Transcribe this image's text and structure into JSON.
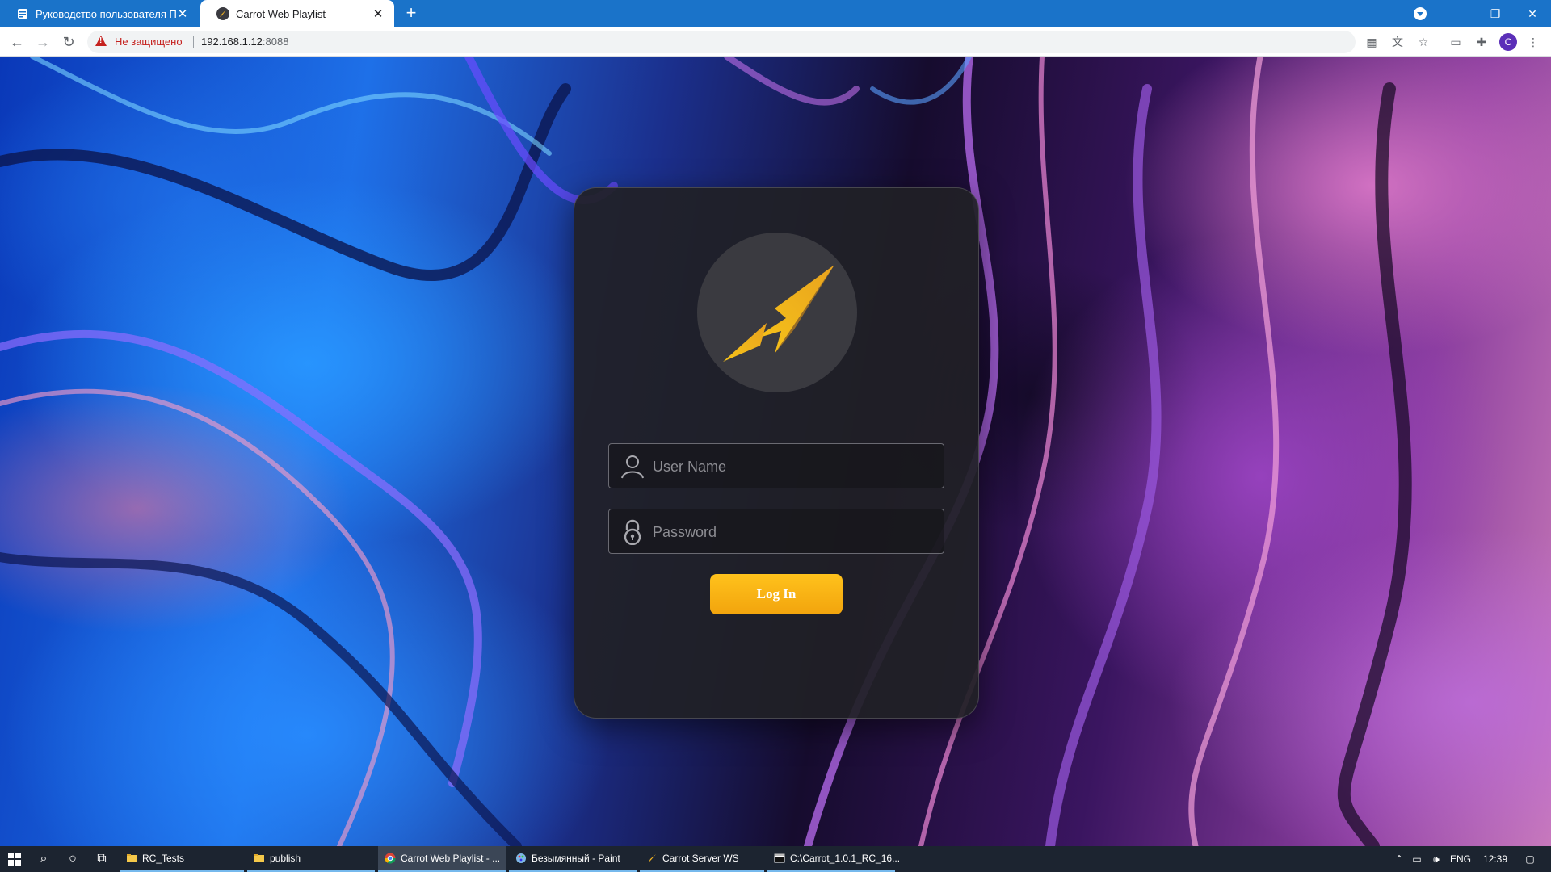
{
  "browser": {
    "tabs": [
      {
        "title": "Руководство пользователя ПО",
        "active": false,
        "icon": "document-icon"
      },
      {
        "title": "Carrot Web Playlist",
        "active": true,
        "icon": "carrot-logo-icon"
      }
    ],
    "address": {
      "security_label": "Не защищено",
      "host": "192.168.1.12",
      "port": ":8088"
    },
    "profile_initial": "C",
    "toolbar_icons": [
      "qr-code-icon",
      "translate-icon",
      "star-icon",
      "cast-icon",
      "extensions-icon",
      "profile-avatar",
      "menu-kebab-icon"
    ]
  },
  "login": {
    "username_placeholder": "User Name",
    "password_placeholder": "Password",
    "login_label": "Log In",
    "accent_color": "#f5aa12",
    "icons": {
      "user": "user-icon",
      "password": "lock-icon",
      "logo": "arrow-logo-icon"
    }
  },
  "taskbar": {
    "items": [
      {
        "label": "RC_Tests",
        "icon": "folder-icon",
        "active": false
      },
      {
        "label": "publish",
        "icon": "folder-icon",
        "active": false
      },
      {
        "label": "Carrot Web Playlist - ...",
        "icon": "chrome-icon",
        "active": true
      },
      {
        "label": "Безымянный - Paint",
        "icon": "paint-icon",
        "active": false
      },
      {
        "label": "Carrot Server WS",
        "icon": "carrot-logo-icon",
        "active": false
      },
      {
        "label": "C:\\Carrot_1.0.1_RC_16...",
        "icon": "console-icon",
        "active": false
      }
    ],
    "tray": {
      "language": "ENG",
      "time": "12:39"
    }
  }
}
